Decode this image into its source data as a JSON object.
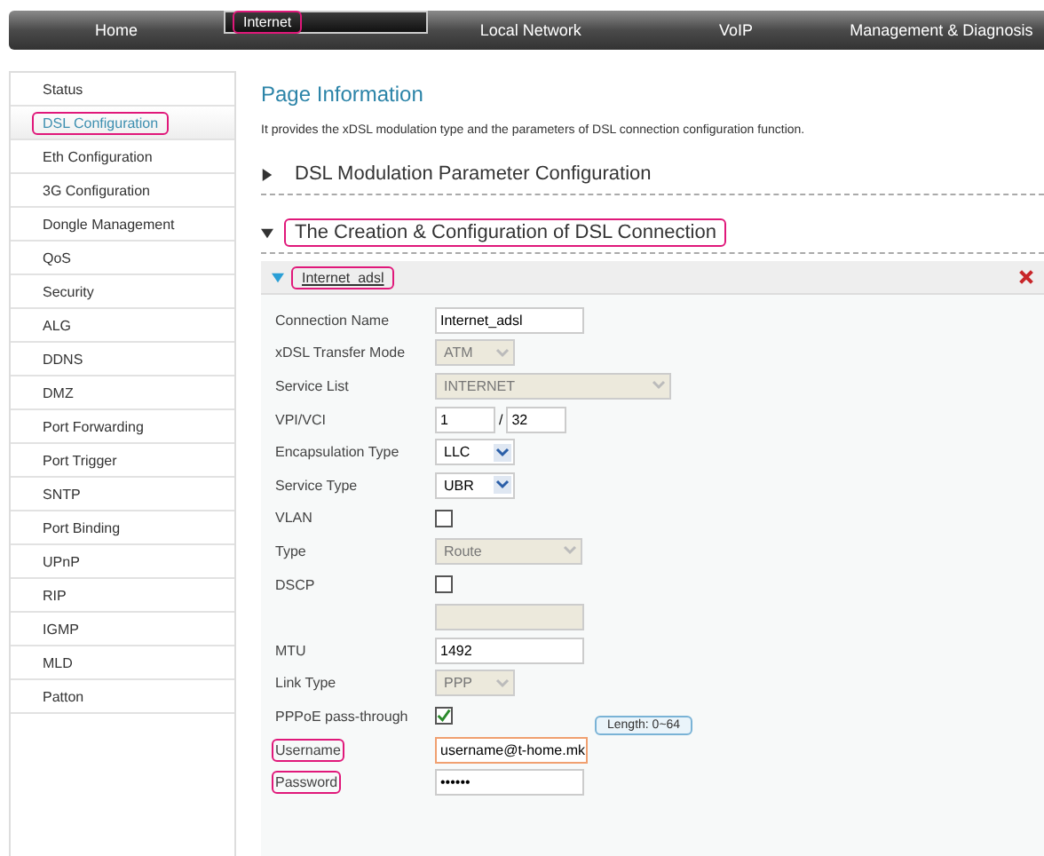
{
  "nav_tabs": [
    {
      "label": "Home",
      "selected": false,
      "highlighted": false
    },
    {
      "label": "Internet",
      "selected": true,
      "highlighted": true
    },
    {
      "label": "Local Network",
      "selected": false,
      "highlighted": false
    },
    {
      "label": "VoIP",
      "selected": false,
      "highlighted": false
    },
    {
      "label": "Management & Diagnosis",
      "selected": false,
      "highlighted": false
    }
  ],
  "sidebar": {
    "items": [
      {
        "label": "Status",
        "selected": false,
        "highlighted": false
      },
      {
        "label": "DSL Configuration",
        "selected": true,
        "highlighted": true
      },
      {
        "label": "Eth Configuration",
        "selected": false,
        "highlighted": false
      },
      {
        "label": "3G Configuration",
        "selected": false,
        "highlighted": false
      },
      {
        "label": "Dongle Management",
        "selected": false,
        "highlighted": false
      },
      {
        "label": "QoS",
        "selected": false,
        "highlighted": false
      },
      {
        "label": "Security",
        "selected": false,
        "highlighted": false
      },
      {
        "label": "ALG",
        "selected": false,
        "highlighted": false
      },
      {
        "label": "DDNS",
        "selected": false,
        "highlighted": false
      },
      {
        "label": "DMZ",
        "selected": false,
        "highlighted": false
      },
      {
        "label": "Port Forwarding",
        "selected": false,
        "highlighted": false
      },
      {
        "label": "Port Trigger",
        "selected": false,
        "highlighted": false
      },
      {
        "label": "SNTP",
        "selected": false,
        "highlighted": false
      },
      {
        "label": "Port Binding",
        "selected": false,
        "highlighted": false
      },
      {
        "label": "UPnP",
        "selected": false,
        "highlighted": false
      },
      {
        "label": "RIP",
        "selected": false,
        "highlighted": false
      },
      {
        "label": "IGMP",
        "selected": false,
        "highlighted": false
      },
      {
        "label": "MLD",
        "selected": false,
        "highlighted": false
      },
      {
        "label": "Patton",
        "selected": false,
        "highlighted": false
      }
    ]
  },
  "page_info": {
    "title": "Page Information",
    "description": "It provides the xDSL modulation type and the parameters of DSL connection configuration function."
  },
  "sections": [
    {
      "title": "DSL Modulation Parameter Configuration",
      "expanded": false,
      "highlighted": false
    },
    {
      "title": "The Creation & Configuration of DSL Connection",
      "expanded": true,
      "highlighted": true
    }
  ],
  "connection": {
    "name": "Internet_adsl",
    "expanded": true,
    "highlighted": true,
    "fields": [
      {
        "kind": "text",
        "label": "Connection Name",
        "value": "Internet_adsl",
        "highlighted": false,
        "focused": false
      },
      {
        "kind": "select",
        "label": "xDSL Transfer Mode",
        "value": "ATM",
        "disabled": true,
        "highlighted": false
      },
      {
        "kind": "select",
        "label": "Service List",
        "value": "INTERNET",
        "disabled": true,
        "highlighted": false
      },
      {
        "kind": "pair",
        "label": "VPI/VCI",
        "value": "1",
        "separator": "/",
        "value2": "32",
        "highlighted": false
      },
      {
        "kind": "select",
        "label": "Encapsulation Type",
        "value": "LLC",
        "disabled": false,
        "highlighted": false
      },
      {
        "kind": "select",
        "label": "Service Type",
        "value": "UBR",
        "disabled": false,
        "highlighted": false
      },
      {
        "kind": "checkbox",
        "label": "VLAN",
        "checked": false,
        "highlighted": false
      },
      {
        "kind": "select",
        "label": "Type",
        "value": "Route",
        "disabled": true,
        "highlighted": false
      },
      {
        "kind": "checkbox",
        "label": "DSCP",
        "checked": false,
        "highlighted": false
      },
      {
        "kind": "blank",
        "disabled": true
      },
      {
        "kind": "text",
        "label": "MTU",
        "value": "1492",
        "highlighted": false,
        "focused": false
      },
      {
        "kind": "select",
        "label": "Link Type",
        "value": "PPP",
        "disabled": true,
        "highlighted": false
      },
      {
        "kind": "checkbox",
        "label": "PPPoE pass-through",
        "checked": true,
        "highlighted": false
      },
      {
        "kind": "text",
        "label": "Username",
        "value": "username@t-home.mk",
        "highlighted": true,
        "focused": true,
        "tooltip": "Length: 0~64"
      },
      {
        "kind": "text",
        "label": "Password",
        "value": "••••••",
        "highlighted": true,
        "focused": false
      }
    ]
  }
}
